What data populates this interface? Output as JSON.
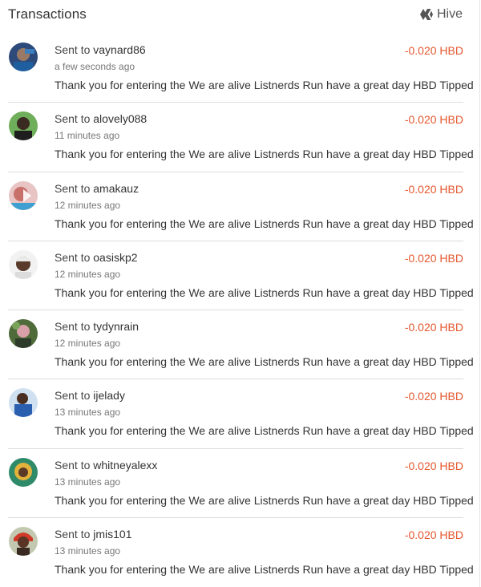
{
  "header": {
    "title": "Transactions",
    "chain_label": "Hive",
    "chain_icon": "hive-logo-icon"
  },
  "colors": {
    "amount_negative": "#e4572e",
    "divider": "#dddddd"
  },
  "transactions": [
    {
      "prefix": "Sent to",
      "account": "vaynard86",
      "time": "a few seconds ago",
      "memo": "Thank you for entering the We are alive Listnerds Run have a great day HBD Tipped",
      "amount": "-0.020 HBD"
    },
    {
      "prefix": "Sent to",
      "account": "alovely088",
      "time": "11 minutes ago",
      "memo": "Thank you for entering the We are alive Listnerds Run have a great day HBD Tipped",
      "amount": "-0.020 HBD"
    },
    {
      "prefix": "Sent to",
      "account": "amakauz",
      "time": "12 minutes ago",
      "memo": "Thank you for entering the We are alive Listnerds Run have a great day HBD Tipped",
      "amount": "-0.020 HBD"
    },
    {
      "prefix": "Sent to",
      "account": "oasiskp2",
      "time": "12 minutes ago",
      "memo": "Thank you for entering the We are alive Listnerds Run have a great day HBD Tipped",
      "amount": "-0.020 HBD"
    },
    {
      "prefix": "Sent to",
      "account": "tydynrain",
      "time": "12 minutes ago",
      "memo": "Thank you for entering the We are alive Listnerds Run have a great day HBD Tipped",
      "amount": "-0.020 HBD"
    },
    {
      "prefix": "Sent to",
      "account": "ijelady",
      "time": "13 minutes ago",
      "memo": "Thank you for entering the We are alive Listnerds Run have a great day HBD Tipped",
      "amount": "-0.020 HBD"
    },
    {
      "prefix": "Sent to",
      "account": "whitneyalexx",
      "time": "13 minutes ago",
      "memo": "Thank you for entering the We are alive Listnerds Run have a great day HBD Tipped",
      "amount": "-0.020 HBD"
    },
    {
      "prefix": "Sent to",
      "account": "jmis101",
      "time": "13 minutes ago",
      "memo": "Thank you for entering the We are alive Listnerds Run have a great day HBD Tipped",
      "amount": "-0.020 HBD"
    }
  ]
}
